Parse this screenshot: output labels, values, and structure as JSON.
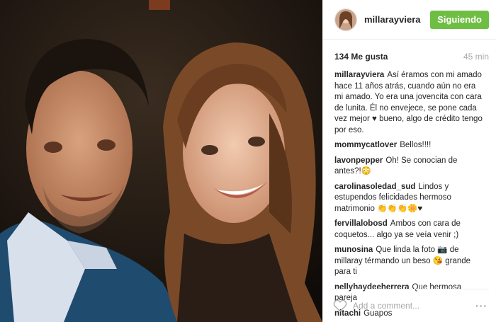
{
  "post": {
    "username": "millarayviera",
    "follow_label": "Siguiendo",
    "likes": "134 Me gusta",
    "time": "45 min",
    "comments": [
      {
        "user": "millarayviera",
        "text": "Así éramos con mi amado hace 11 años atrás, cuando aún no era mi amado. Yo era una jovencita con cara de lunita. Él no envejece, se pone cada vez mejor ♥ bueno, algo de crédito tengo por eso."
      },
      {
        "user": "mommycatlover",
        "text": "Bellos!!!!"
      },
      {
        "user": "lavonpepper",
        "text": "Oh! Se conocian de antes?!😳"
      },
      {
        "user": "carolinasoledad_sud",
        "text": "Lindos y estupendos felicidades hermoso matrimonio 👏👏👏🌼♥"
      },
      {
        "user": "fervillalobosd",
        "text": "Ambos con cara de coquetos... algo ya se veía venir ;)"
      },
      {
        "user": "munosina",
        "text": "Que linda la foto 📷 de millaray térmando un beso 😘 grande para ti"
      },
      {
        "user": "nellyhaydeeherrera",
        "text": "Que hermosa pareja"
      },
      {
        "user": "nitachi",
        "text": "Guapos"
      }
    ],
    "add_comment_placeholder": "Add a comment...",
    "more_label": "···"
  },
  "icons": {
    "like": "heart-outline-icon",
    "more": "more-options-icon"
  },
  "colors": {
    "follow_button": "#6fbe44",
    "muted": "#a5a7aa",
    "text": "#262626"
  }
}
